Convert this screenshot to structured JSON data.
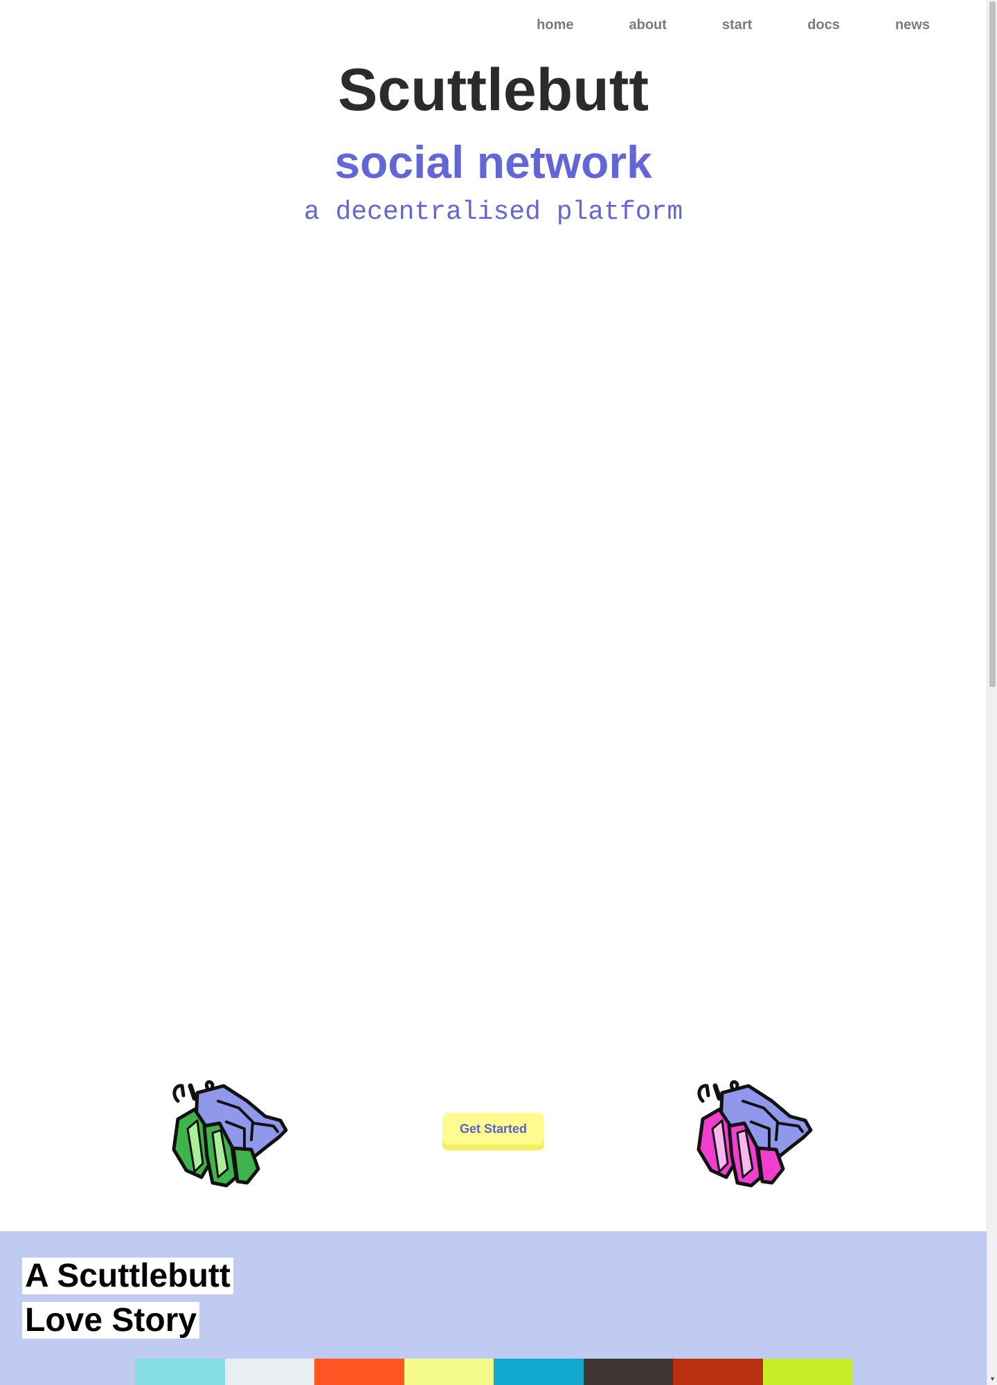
{
  "nav": {
    "items": [
      {
        "label": "home"
      },
      {
        "label": "about"
      },
      {
        "label": "start"
      },
      {
        "label": "docs"
      },
      {
        "label": "news"
      }
    ]
  },
  "hero": {
    "title": "Scuttlebutt",
    "subtitle": "social network",
    "tagline": "a decentralised platform"
  },
  "cta": {
    "label": "Get Started"
  },
  "mascots": {
    "left_icon": "green-hermit-crab-icon",
    "right_icon": "pink-hermit-crab-icon"
  },
  "story": {
    "title_line1": "A Scuttlebutt",
    "title_line2": "Love Story"
  },
  "palette": [
    "#85dde3",
    "#e8eef2",
    "#ff5522",
    "#f4fb88",
    "#12a7cc",
    "#3f3533",
    "#b8300e",
    "#c8ec28"
  ],
  "colors": {
    "accent": "#6366d6",
    "cta_bg": "#fffb8f",
    "story_bg": "#bfcbf0"
  }
}
